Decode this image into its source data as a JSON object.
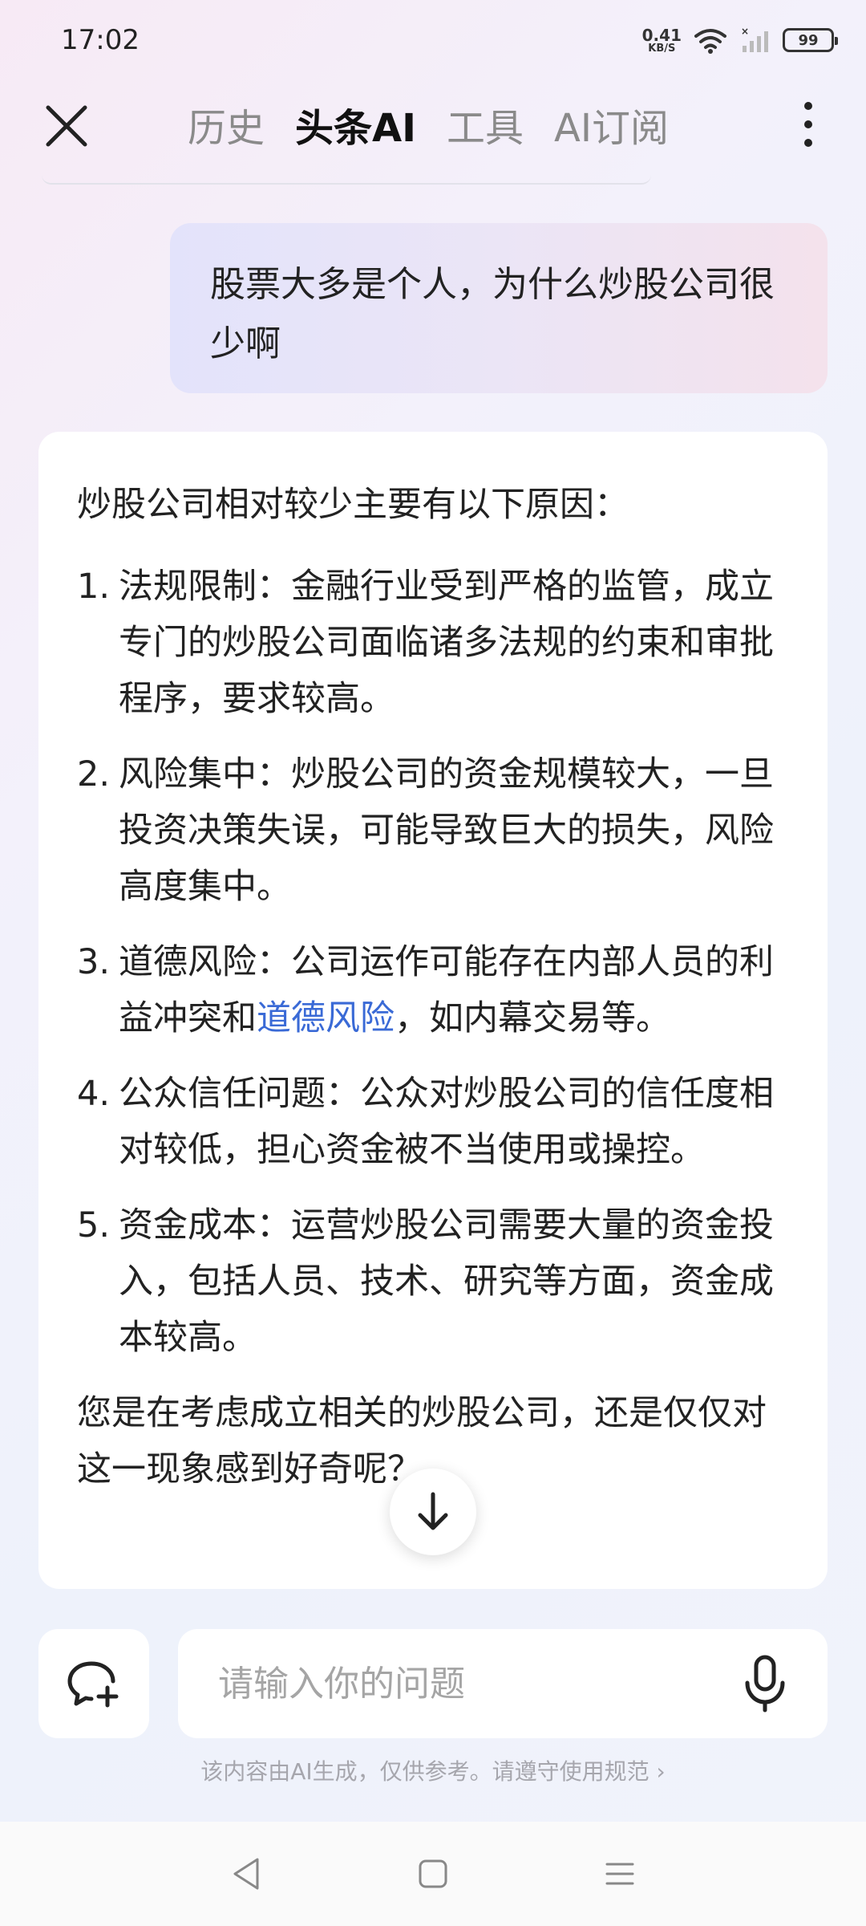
{
  "status_bar": {
    "time": "17:02",
    "net_speed_value": "0.41",
    "net_speed_unit": "KB/S",
    "battery": "99"
  },
  "nav": {
    "tabs": [
      {
        "label": "历史",
        "active": false
      },
      {
        "label": "头条AI",
        "active": true
      },
      {
        "label": "工具",
        "active": false
      },
      {
        "label": "AI订阅",
        "active": false
      }
    ]
  },
  "chat": {
    "user_message": "股票大多是个人，为什么炒股公司很少啊",
    "answer": {
      "intro": "炒股公司相对较少主要有以下原因：",
      "reasons": [
        {
          "num": "1.",
          "text": "法规限制：金融行业受到严格的监管，成立专门的炒股公司面临诸多法规的约束和审批程序，要求较高。"
        },
        {
          "num": "2.",
          "text": "风险集中：炒股公司的资金规模较大，一旦投资决策失误，可能导致巨大的损失，风险高度集中。"
        },
        {
          "num": "3.",
          "text_before": "道德风险：公司运作可能存在内部人员的利益冲突和",
          "link": "道德风险",
          "text_after": "，如内幕交易等。"
        },
        {
          "num": "4.",
          "text": "公众信任问题：公众对炒股公司的信任度相对较低，担心资金被不当使用或操控。"
        },
        {
          "num": "5.",
          "text": "资金成本：运营炒股公司需要大量的资金投入，包括人员、技术、研究等方面，资金成本较高。"
        }
      ],
      "closing": "您是在考虑成立相关的炒股公司，还是仅仅对这一现象感到好奇呢？"
    }
  },
  "input": {
    "placeholder": "请输入你的问题"
  },
  "disclaimer": {
    "text": "该内容由AI生成，仅供参考。请遵守",
    "rules_link": "使用规范 ›"
  },
  "colors": {
    "link": "#3a6ad6",
    "active_tab": "#111111",
    "inactive_tab": "#8a8a8a"
  },
  "icons": {
    "close": "close-icon",
    "more": "more-vertical-icon",
    "scroll_down": "arrow-down-icon",
    "new_chat": "new-chat-icon",
    "mic": "microphone-icon",
    "wifi": "wifi-icon",
    "signal": "signal-icon",
    "battery": "battery-icon"
  }
}
